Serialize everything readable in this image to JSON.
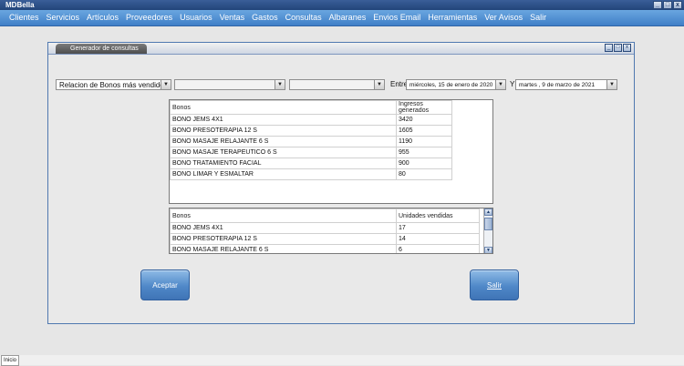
{
  "app": {
    "title": "MDBella",
    "window_controls": [
      "_",
      "□",
      "x"
    ]
  },
  "menu": [
    "Clientes",
    "Servicios",
    "Artículos",
    "Proveedores",
    "Usuarios",
    "Ventas",
    "Gastos",
    "Consultas",
    "Albaranes",
    "Envios Email",
    "Herramientas",
    "Ver Avisos",
    "Salir"
  ],
  "dialog": {
    "title": "Generador de consultas",
    "controls": [
      "_",
      "□",
      "x"
    ],
    "query_select": "Relacion de Bonos más vendidos",
    "filter1": "",
    "filter2": "",
    "between_label": "Entre",
    "date_from": "miércoles, 15 de    enero    de 2020",
    "and_label": "Y",
    "date_to": "martes   ,   9 de    marzo    de 2021",
    "ingresos_table": {
      "headers": [
        "Bonos",
        "Ingresos generados"
      ],
      "rows": [
        [
          "BONO JEMS 4X1",
          "3420"
        ],
        [
          "BONO PRESOTERAPIA 12 S",
          "1605"
        ],
        [
          "BONO MASAJE RELAJANTE 6 S",
          "1190"
        ],
        [
          "BONO MASAJE TERAPEUTICO 6 S",
          "955"
        ],
        [
          "BONO TRATAMIENTO FACIAL",
          "900"
        ],
        [
          "BONO LIMAR Y ESMALTAR",
          "80"
        ]
      ]
    },
    "unidades_table": {
      "headers": [
        "Bonos",
        "Unidades vendidas"
      ],
      "rows": [
        [
          "BONO JEMS 4X1",
          "17"
        ],
        [
          "BONO PRESOTERAPIA 12 S",
          "14"
        ],
        [
          "BONO MASAJE RELAJANTE 6 S",
          "6"
        ]
      ]
    },
    "accept_label": "Aceptar",
    "exit_label": "Salir"
  },
  "taskbar": {
    "start_label": "Inicio"
  }
}
